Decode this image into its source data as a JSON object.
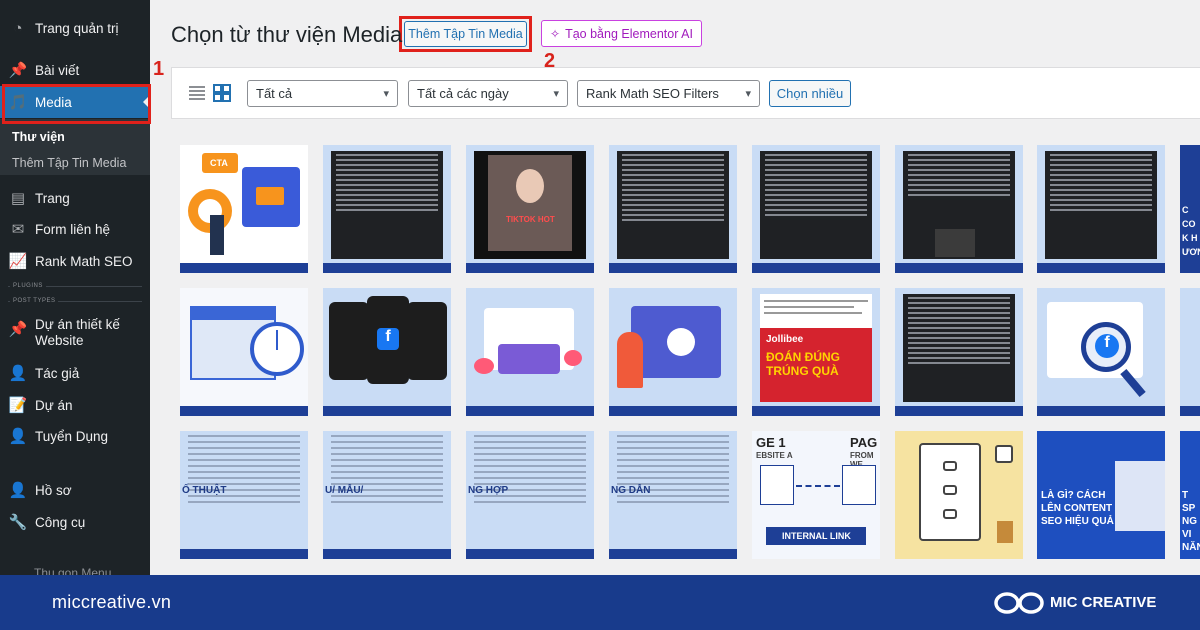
{
  "sidebar": {
    "items": [
      {
        "label": "Trang quản trị",
        "icon": "dashboard-icon"
      },
      {
        "label": "Bài viết",
        "icon": "pin-icon"
      },
      {
        "label": "Media",
        "icon": "media-icon"
      },
      {
        "label": "Trang",
        "icon": "page-icon"
      },
      {
        "label": "Form liên hệ",
        "icon": "mail-icon"
      },
      {
        "label": "Rank Math SEO",
        "icon": "chart-icon"
      },
      {
        "label": "Dự án thiết kế Website",
        "icon": "pin-icon"
      },
      {
        "label": "Tác giả",
        "icon": "user-icon"
      },
      {
        "label": "Dự án",
        "icon": "document-icon"
      },
      {
        "label": "Tuyển Dụng",
        "icon": "user-icon"
      },
      {
        "label": "Hồ sơ",
        "icon": "user-icon"
      },
      {
        "label": "Công cụ",
        "icon": "wrench-icon"
      }
    ],
    "submenu": [
      {
        "label": "Thư viện"
      },
      {
        "label": "Thêm Tập Tin Media"
      }
    ],
    "separators": [
      "PLUGINS",
      "POST TYPES"
    ],
    "collapse_label": "Thu gọn Menu"
  },
  "annotations": {
    "one": "1",
    "two": "2"
  },
  "main": {
    "title": "Chọn từ thư viện Media",
    "add_button": "Thêm Tập Tin Media",
    "ai_button": "Tạo bằng Elementor AI"
  },
  "toolbar": {
    "filter_type": "Tất cả",
    "filter_date": "Tất cả các ngày",
    "filter_seo": "Rank Math SEO Filters",
    "select_multiple": "Chọn nhiều"
  },
  "tiles": {
    "cta": "CTA",
    "jollibee_brand": "Jollibee",
    "jollibee_text": "ĐOÁN ĐÚNG TRÚNG QUÀ",
    "internal_link": "INTERNAL LINK",
    "pag_a": "GE 1",
    "pag_b": "PAG",
    "pag_c": "EBSITE A",
    "pag_d": "FROM WE",
    "tv_partial": "TIKTOK HOT",
    "r3a": "Ố THUẬT",
    "r3b": "U/ MẪU/",
    "r3c": "NG HỢP",
    "r3d": "NG DẪN",
    "r3e": "LÀ GÌ? CÁCH LÊN CONTENT SEO HIỆU QUẢ",
    "r3f": "T SP NG VI NĂN",
    "r1g": "C CO K H ƯƠNG"
  },
  "footer": {
    "site": "miccreative.vn",
    "brand": "MIC CREATIVE"
  }
}
